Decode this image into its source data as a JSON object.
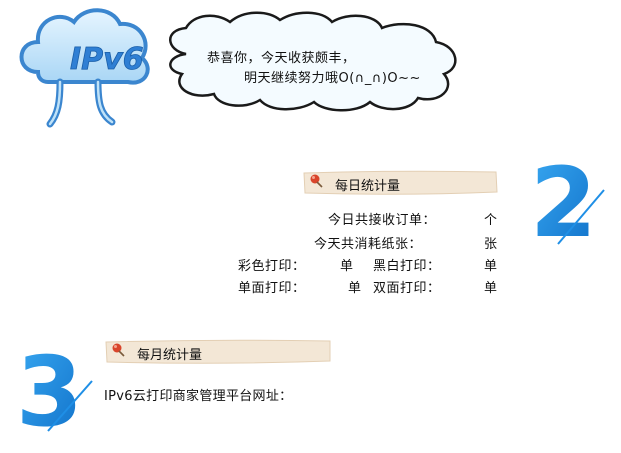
{
  "logo": {
    "text": "IPv6"
  },
  "bubble": {
    "line1": "恭喜你，今天收获颇丰，",
    "line2": "明天继续努力哦O(∩_∩)O~~"
  },
  "daily": {
    "number": "2",
    "title": "每日统计量",
    "rows": {
      "total_orders_label": "今日共接收订单：",
      "total_orders_unit": "个",
      "paper_label": "今天共消耗纸张：",
      "paper_unit": "张",
      "color_label": "彩色打印：",
      "color_unit": "单",
      "bw_label": "黑白打印：",
      "bw_unit": "单",
      "single_label": "单面打印：",
      "single_unit": "单",
      "double_label": "双面打印：",
      "double_unit": "单"
    }
  },
  "monthly": {
    "number": "3",
    "title": "每月统计量",
    "platform_label": "IPv6云打印商家管理平台网址："
  },
  "colors": {
    "logo_blue": "#2f7fd4",
    "logo_light": "#bfe2f8",
    "cloud_fill": "#f4fbff",
    "cloud_stroke": "#1a1a1a",
    "banner_fill": "#f3e7d6",
    "numeral_blue": "#1f8fe6",
    "pin_red": "#d9452b"
  }
}
